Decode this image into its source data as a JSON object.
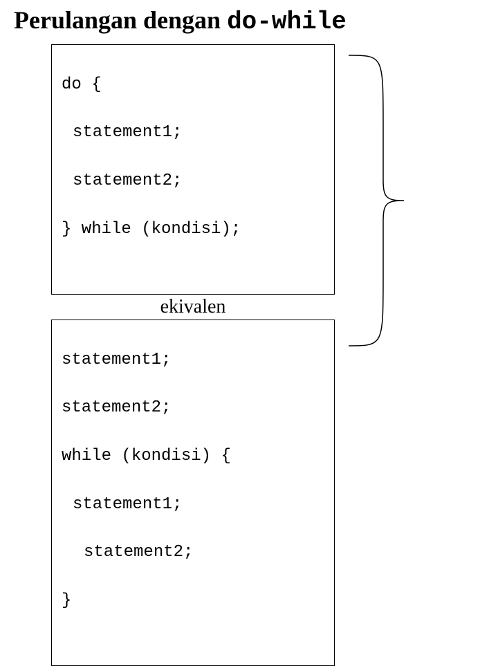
{
  "title": {
    "prefix": "Perulangan dengan ",
    "mono": "do-while"
  },
  "ekiv_label": "ekivalen",
  "box1": {
    "l1": "do {",
    "l2": "statement1;",
    "l3": "statement2;",
    "l4": "} while (kondisi);"
  },
  "box2": {
    "l1": "statement1;",
    "l2": "statement2;",
    "l3": "while (kondisi) {",
    "l4": "statement1;",
    "l5": "statement2;",
    "l6": "}"
  }
}
